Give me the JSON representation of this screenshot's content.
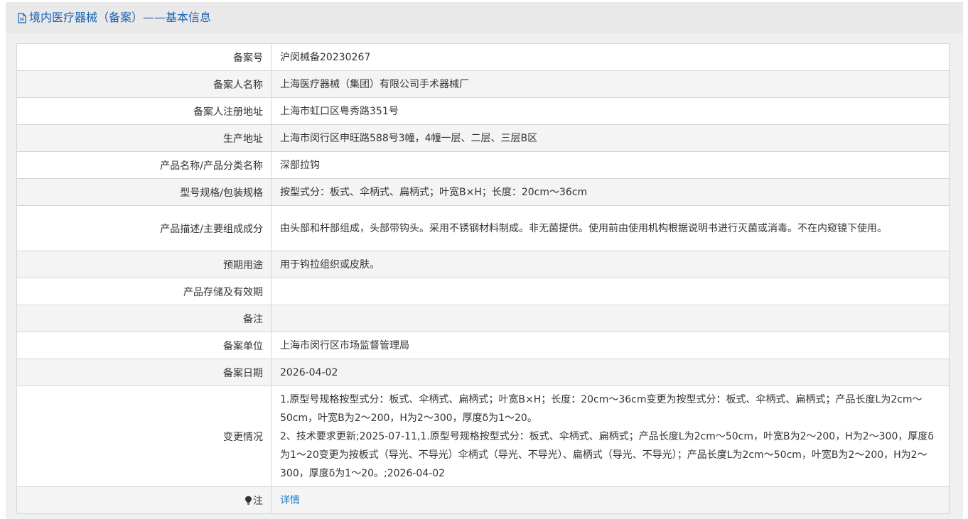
{
  "header": {
    "title": "境内医疗器械（备案）——基本信息"
  },
  "rows": [
    {
      "label": "备案号",
      "value": "沪闵械备20230267"
    },
    {
      "label": "备案人名称",
      "value": "上海医疗器械（集团）有限公司手术器械厂"
    },
    {
      "label": "备案人注册地址",
      "value": "上海市虹口区粤秀路351号"
    },
    {
      "label": "生产地址",
      "value": "上海市闵行区申旺路588号3幢，4幢一层、二层、三层B区"
    },
    {
      "label": "产品名称/产品分类名称",
      "value": "深部拉钩"
    },
    {
      "label": "型号规格/包装规格",
      "value": "按型式分：板式、伞柄式、扁柄式；叶宽B×H；长度：20cm～36cm"
    },
    {
      "label": "产品描述/主要组成成分",
      "value": "由头部和杆部组成，头部带钩头。采用不锈钢材料制成。非无菌提供。使用前由使用机构根据说明书进行灭菌或消毒。不在内窥镜下使用。"
    },
    {
      "label": "预期用途",
      "value": "用于钩拉组织或皮肤。"
    },
    {
      "label": "产品存储及有效期",
      "value": ""
    },
    {
      "label": "备注",
      "value": ""
    },
    {
      "label": "备案单位",
      "value": "上海市闵行区市场监督管理局"
    },
    {
      "label": "备案日期",
      "value": "2026-04-02"
    },
    {
      "label": "变更情况",
      "value": "1.原型号规格按型式分：板式、伞柄式、扁柄式；叶宽B×H；长度：20cm～36cm变更为按型式分：板式、伞柄式、扁柄式；产品长度L为2cm～50cm，叶宽B为2～200，H为2～300，厚度δ为1～20。",
      "value2": "2、技术要求更新;2025-07-11,1.原型号规格按型式分：板式、伞柄式、扁柄式；产品长度L为2cm～50cm，叶宽B为2～200，H为2～300，厚度δ为1～20变更为按板式（导光、不导光）伞柄式（导光、不导光）、扁柄式（导光、不导光）；产品长度L为2cm～50cm，叶宽B为2～200，H为2～300，厚度δ为1～20。;2026-04-02"
    }
  ],
  "note": {
    "label": "注",
    "link_text": "详情"
  },
  "icons": {
    "header_icon": "document-icon",
    "note_icon": "lightbulb-icon"
  },
  "colors": {
    "title": "#1a64b4",
    "link": "#1e7ec8",
    "border": "#cfd7dc",
    "header_bg": "#e9e9e9",
    "stripe_bg": "#f4f4f4"
  }
}
